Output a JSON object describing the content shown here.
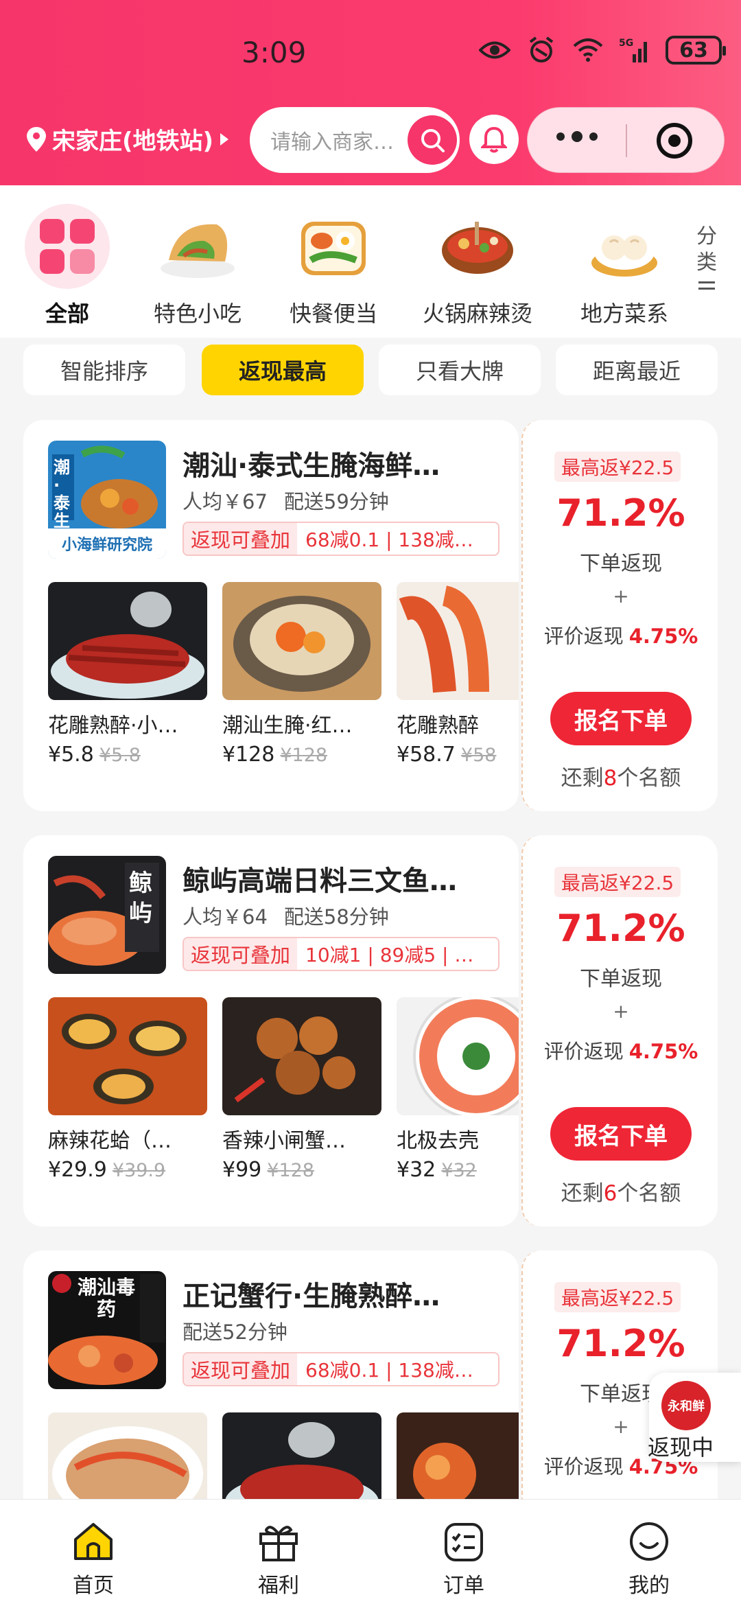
{
  "status_bar": {
    "time": "3:09",
    "battery": "63"
  },
  "header": {
    "location": "宋家庄(地铁站)",
    "search_placeholder": "请输入商家…"
  },
  "categories": [
    {
      "label": "全部",
      "icon": "all-grid-icon"
    },
    {
      "label": "特色小吃",
      "icon": "wrap-food-icon"
    },
    {
      "label": "快餐便当",
      "icon": "bento-icon"
    },
    {
      "label": "火锅麻辣烫",
      "icon": "hotpot-icon"
    },
    {
      "label": "地方菜系",
      "icon": "dumpling-icon"
    }
  ],
  "categories_more": {
    "label_1": "分",
    "label_2": "类"
  },
  "sort_options": [
    "智能排序",
    "返现最高",
    "只看大牌",
    "距离最近"
  ],
  "sort_selected": "返现最高",
  "shops": [
    {
      "name": "潮汕·泰式生腌海鲜…",
      "avg_price": "人均￥67",
      "delivery": "配送59分钟",
      "promo_tag": "返现可叠加",
      "promo_text": "68减0.1 | 138减…",
      "logo_text": "潮·泰生腌",
      "logo_caption": "小海鲜研究院",
      "dishes": [
        {
          "name": "花雕熟醉·小…",
          "price": "¥5.8",
          "original": "¥5.8"
        },
        {
          "name": "潮汕生腌·红…",
          "price": "¥128",
          "original": "¥128"
        },
        {
          "name": "花雕熟醉",
          "price": "¥58.7",
          "original": "¥58"
        }
      ],
      "max_cashback": "最高返¥22.5",
      "rate": "71.2%",
      "rate_label": "下单返现",
      "plus": "+",
      "review_label": "评价返现",
      "review_rate": "4.75%",
      "join_label": "报名下单",
      "quota_prefix": "还剩",
      "quota_count": "8",
      "quota_suffix": "个名额"
    },
    {
      "name": "鲸屿高端日料三文鱼…",
      "avg_price": "人均￥64",
      "delivery": "配送58分钟",
      "promo_tag": "返现可叠加",
      "promo_text": "10减1 | 89减5 | …",
      "logo_text": "鲸屿",
      "logo_caption": "",
      "dishes": [
        {
          "name": "麻辣花蛤（…",
          "price": "¥29.9",
          "original": "¥39.9"
        },
        {
          "name": "香辣小闸蟹…",
          "price": "¥99",
          "original": "¥128"
        },
        {
          "name": "北极去壳",
          "price": "¥32",
          "original": "¥32"
        }
      ],
      "max_cashback": "最高返¥22.5",
      "rate": "71.2%",
      "rate_label": "下单返现",
      "plus": "+",
      "review_label": "评价返现",
      "review_rate": "4.75%",
      "join_label": "报名下单",
      "quota_prefix": "还剩",
      "quota_count": "6",
      "quota_suffix": "个名额"
    },
    {
      "name": "正记蟹行·生腌熟醉…",
      "avg_price": "",
      "delivery": "配送52分钟",
      "promo_tag": "返现可叠加",
      "promo_text": "68减0.1 | 138减…",
      "logo_text": "潮汕毒药",
      "logo_caption": "",
      "dishes": [
        {
          "name": "",
          "price": "",
          "original": ""
        },
        {
          "name": "",
          "price": "",
          "original": ""
        },
        {
          "name": "",
          "price": "",
          "original": ""
        }
      ],
      "max_cashback": "最高返¥22.5",
      "rate": "71.2%",
      "rate_label": "下单返现",
      "plus": "+",
      "review_label": "评价返现",
      "review_rate": "4.75%"
    }
  ],
  "floating_badge": {
    "logo_text": "永和鲜",
    "label": "返现中"
  },
  "tabs": [
    {
      "label": "首页",
      "icon": "home-icon",
      "active": true
    },
    {
      "label": "福利",
      "icon": "gift-icon",
      "active": false
    },
    {
      "label": "订单",
      "icon": "order-list-icon",
      "active": false
    },
    {
      "label": "我的",
      "icon": "smile-profile-icon",
      "active": false
    }
  ],
  "colors": {
    "brand": "#f6356a",
    "accent_yellow": "#ffd400",
    "cashback_red": "#e8212b"
  }
}
